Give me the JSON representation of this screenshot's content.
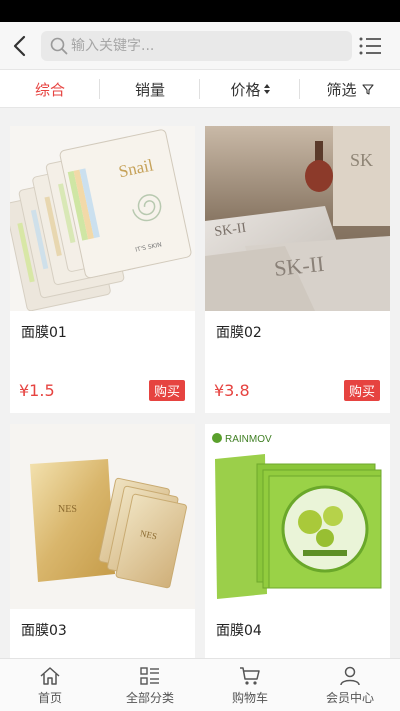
{
  "search": {
    "placeholder": "输入关键字..."
  },
  "sort_tabs": [
    {
      "label": "综合",
      "active": true
    },
    {
      "label": "销量",
      "active": false
    },
    {
      "label": "价格",
      "active": false
    },
    {
      "label": "筛选",
      "active": false
    }
  ],
  "products": [
    {
      "name": "面膜01",
      "price": "¥1.5",
      "buy_label": "购买",
      "image_brand": "Snail"
    },
    {
      "name": "面膜02",
      "price": "¥3.8",
      "buy_label": "购买",
      "image_brand": "SK-II"
    },
    {
      "name": "面膜03",
      "price": "",
      "buy_label": "",
      "image_brand": "NES"
    },
    {
      "name": "面膜04",
      "price": "",
      "buy_label": "",
      "image_brand": "RAINMOV"
    }
  ],
  "tabbar": [
    {
      "label": "首页",
      "icon": "home-icon"
    },
    {
      "label": "全部分类",
      "icon": "category-icon"
    },
    {
      "label": "购物车",
      "icon": "cart-icon"
    },
    {
      "label": "会员中心",
      "icon": "user-icon"
    }
  ],
  "colors": {
    "accent": "#e64340",
    "header_bg": "#f7f7f7",
    "page_bg": "#f2f2f2"
  }
}
